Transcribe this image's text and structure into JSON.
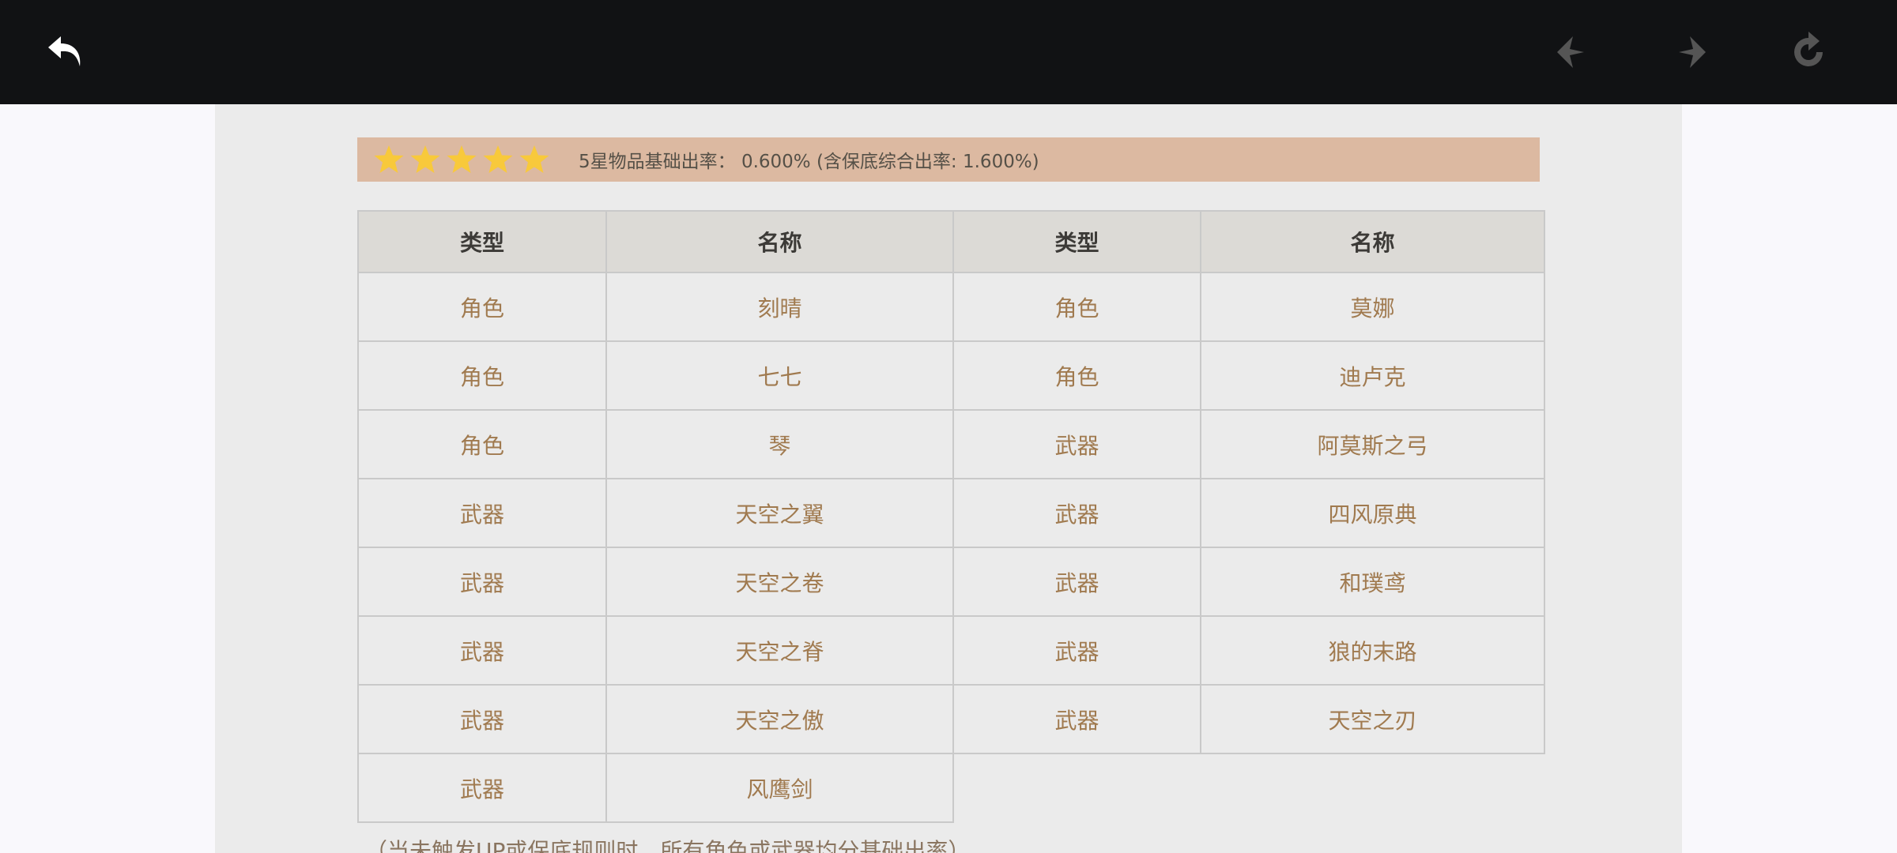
{
  "toolbar": {
    "back_icon": "back-arrow-icon",
    "prev_icon": "prev-diamond-icon",
    "next_icon": "next-diamond-icon",
    "reload_icon": "reload-icon",
    "colors": {
      "background": "#111214",
      "icon_active": "#ffffff",
      "icon_disabled": "#555555"
    }
  },
  "rate": {
    "stars": 5,
    "text": "5星物品基础出率： 0.600% (含保底综合出率: 1.600%)",
    "colors": {
      "bar": "#dcb9a1",
      "star": "#f8c93b"
    }
  },
  "table": {
    "headers": [
      "类型",
      "名称",
      "类型",
      "名称"
    ],
    "rows": [
      [
        "角色",
        "刻晴",
        "角色",
        "莫娜"
      ],
      [
        "角色",
        "七七",
        "角色",
        "迪卢克"
      ],
      [
        "角色",
        "琴",
        "武器",
        "阿莫斯之弓"
      ],
      [
        "武器",
        "天空之翼",
        "武器",
        "四风原典"
      ],
      [
        "武器",
        "天空之卷",
        "武器",
        "和璞鸢"
      ],
      [
        "武器",
        "天空之脊",
        "武器",
        "狼的末路"
      ],
      [
        "武器",
        "天空之傲",
        "武器",
        "天空之刃"
      ],
      [
        "武器",
        "风鹰剑",
        "",
        ""
      ]
    ],
    "colors": {
      "header_bg": "#dcdad6",
      "cell_text": "#a07a4f",
      "border": "#c9c9c9"
    }
  },
  "note": "（当未触发UP或保底规则时，所有角色或武器均分基础出率）"
}
